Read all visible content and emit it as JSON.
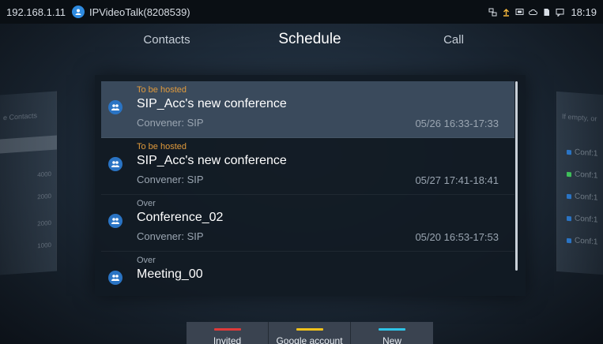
{
  "statusbar": {
    "ip": "192.168.1.11",
    "app_name": "IPVideoTalk(8208539)",
    "time": "18:19"
  },
  "tabs": [
    {
      "label": "Contacts"
    },
    {
      "label": "Schedule",
      "active": true
    },
    {
      "label": "Call"
    }
  ],
  "conferences": [
    {
      "status": "To be hosted",
      "status_color": "#e09a3c",
      "title": "SIP_Acc's new conference",
      "convener": "Convener: SIP",
      "time": "05/26 16:33-17:33"
    },
    {
      "status": "To be hosted",
      "status_color": "#e09a3c",
      "title": "SIP_Acc's new conference",
      "convener": "Convener: SIP",
      "time": "05/27 17:41-18:41"
    },
    {
      "status": "Over",
      "status_color": "#9aa5b1",
      "title": "Conference_02",
      "convener": "Convener: SIP",
      "time": "05/20 16:53-17:53"
    },
    {
      "status": "Over",
      "status_color": "#9aa5b1",
      "title": "Meeting_00",
      "convener": "",
      "time": ""
    }
  ],
  "softkeys": [
    {
      "label": "Invited",
      "color": "#e03a3a"
    },
    {
      "label": "Google account",
      "color": "#f2c21b"
    },
    {
      "label": "New",
      "color": "#2ec4e8"
    }
  ],
  "ghost_left": {
    "title": "e Contacts",
    "numbers": [
      "4000",
      "2000",
      "2000",
      "1000"
    ]
  },
  "ghost_right": {
    "title": "If empty, or",
    "items": [
      {
        "label": "Conf:1",
        "color": "#2a74c4"
      },
      {
        "label": "Conf:1",
        "color": "#3fbf5a"
      },
      {
        "label": "Conf:1",
        "color": "#2a74c4"
      },
      {
        "label": "Conf:1",
        "color": "#2a74c4"
      },
      {
        "label": "Conf:1",
        "color": "#2a74c4"
      }
    ]
  },
  "colors": {
    "accent": "#2a74c4",
    "selected_row": "#3a4a5c"
  }
}
